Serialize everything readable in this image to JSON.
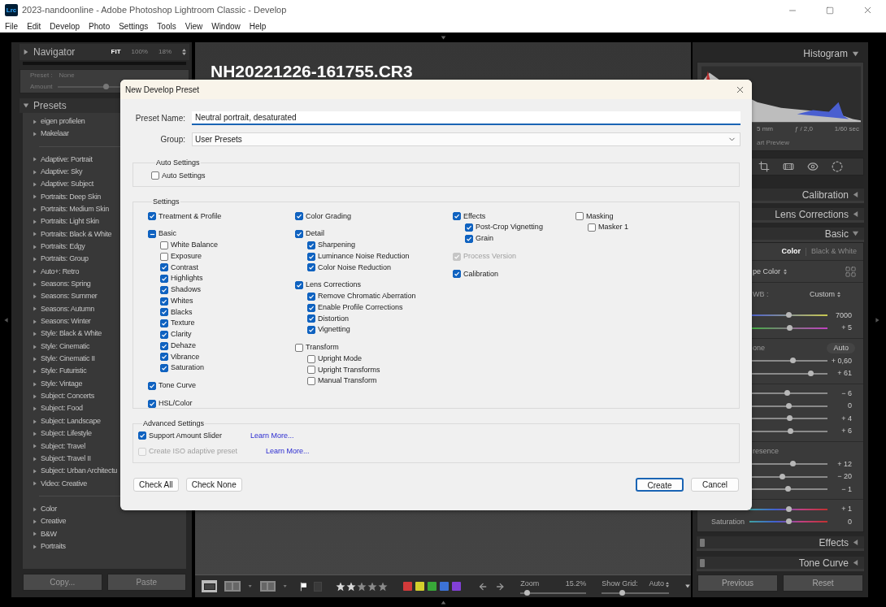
{
  "window": {
    "app_badge": "Lrc",
    "title": "2023-nandoonline - Adobe Photoshop Lightroom Classic - Develop"
  },
  "menu": [
    "File",
    "Edit",
    "Develop",
    "Photo",
    "Settings",
    "Tools",
    "View",
    "Window",
    "Help"
  ],
  "navigator": {
    "title": "Navigator",
    "zoom_options": [
      {
        "label": "FIT",
        "selected": true
      },
      {
        "label": "100%",
        "selected": false
      },
      {
        "label": "18%",
        "selected": false
      }
    ],
    "preset_label": "Preset :",
    "preset_value": "None",
    "amount": {
      "label": "Amount",
      "level": 0.4
    }
  },
  "presets": {
    "title": "Presets",
    "groups": [
      {
        "items": [
          {
            "label": "eigen profielen",
            "expanded": false
          },
          {
            "label": "Makelaar",
            "expanded": false
          }
        ]
      },
      {
        "items": [
          {
            "label": "Adaptive: Portrait",
            "expanded": false
          },
          {
            "label": "Adaptive: Sky",
            "expanded": false
          },
          {
            "label": "Adaptive: Subject",
            "expanded": false
          },
          {
            "label": "Portraits: Deep Skin",
            "expanded": false
          },
          {
            "label": "Portraits: Medium Skin",
            "expanded": false
          },
          {
            "label": "Portraits: Light Skin",
            "expanded": false
          },
          {
            "label": "Portraits: Black & White",
            "expanded": false
          },
          {
            "label": "Portraits: Edgy",
            "expanded": false
          },
          {
            "label": "Portraits: Group",
            "expanded": false
          },
          {
            "label": "Auto+: Retro",
            "expanded": false
          },
          {
            "label": "Seasons: Spring",
            "expanded": false
          },
          {
            "label": "Seasons: Summer",
            "expanded": false
          },
          {
            "label": "Seasons: Autumn",
            "expanded": false
          },
          {
            "label": "Seasons: Winter",
            "expanded": false
          },
          {
            "label": "Style: Black & White",
            "expanded": false
          },
          {
            "label": "Style: Cinematic",
            "expanded": false
          },
          {
            "label": "Style: Cinematic II",
            "expanded": false
          },
          {
            "label": "Style: Futuristic",
            "expanded": false
          },
          {
            "label": "Style: Vintage",
            "expanded": false
          },
          {
            "label": "Subject: Concerts",
            "expanded": false
          },
          {
            "label": "Subject: Food",
            "expanded": false
          },
          {
            "label": "Subject: Landscape",
            "expanded": false
          },
          {
            "label": "Subject: Lifestyle",
            "expanded": false
          },
          {
            "label": "Subject: Travel",
            "expanded": false
          },
          {
            "label": "Subject: Travel II",
            "expanded": false
          },
          {
            "label": "Subject: Urban Architectu",
            "expanded": false
          },
          {
            "label": "Video: Creative",
            "expanded": false
          }
        ]
      },
      {
        "items": [
          {
            "label": "Color",
            "expanded": false
          },
          {
            "label": "Creative",
            "expanded": false
          },
          {
            "label": "B&W",
            "expanded": false
          },
          {
            "label": "Portraits",
            "expanded": false
          }
        ]
      }
    ]
  },
  "left_buttons": [
    "Copy...",
    "Paste"
  ],
  "photo": {
    "filename": "NH20221226-161755.CR3"
  },
  "toolbar": {
    "stars": 2,
    "color_labels": [
      {
        "color": "#d23a3a"
      },
      {
        "color": "#d4cf2c"
      },
      {
        "color": "#38a838"
      },
      {
        "color": "#3c72d6"
      },
      {
        "color": "#8240d6"
      }
    ],
    "zoom": {
      "label": "Zoom",
      "value": "15.2%",
      "level": 0.1
    },
    "grid": {
      "label": "Show Grid:",
      "value": "Auto",
      "level": 0.3
    }
  },
  "right_panel": {
    "histogram_title": "Histogram",
    "exif": [
      "5 mm",
      "ƒ / 2,0",
      "1/60 sec"
    ],
    "preview_note": "art Preview",
    "collapsed_panels": [
      "Calibration",
      "Lens Corrections"
    ],
    "basic": {
      "title": "Basic",
      "treatments": [
        {
          "label": "Color",
          "selected": true
        },
        {
          "label": "Black & White",
          "selected": false
        }
      ],
      "profile": "pe Color",
      "wb_label": "WB :",
      "wb_value": "Custom",
      "sections": [
        {
          "rows": [
            {
              "kind": "temp",
              "value": "7000",
              "level": 0.5
            },
            {
              "kind": "tint",
              "value": "+ 5",
              "level": 0.52
            }
          ]
        },
        {
          "heading": "one",
          "button": "Auto",
          "rows": [
            {
              "kind": "plain",
              "value": "+ 0,60",
              "level": 0.56
            },
            {
              "kind": "plain",
              "value": "+ 61",
              "level": 0.79
            }
          ]
        },
        {
          "rows": [
            {
              "kind": "plain",
              "value": "− 6",
              "level": 0.48
            },
            {
              "kind": "plain",
              "value": "0",
              "level": 0.5
            },
            {
              "kind": "plain",
              "value": "+ 4",
              "level": 0.52
            },
            {
              "kind": "plain",
              "value": "+ 6",
              "level": 0.53
            }
          ]
        },
        {
          "heading": "resence",
          "rows": [
            {
              "kind": "plain",
              "value": "+ 12",
              "level": 0.56
            },
            {
              "kind": "plain",
              "value": "− 20",
              "level": 0.42
            },
            {
              "kind": "plain",
              "value": "− 1",
              "level": 0.49
            }
          ]
        },
        {
          "rows": [
            {
              "kind": "hue",
              "value": "+ 1",
              "level": 0.51
            },
            {
              "kind": "hue",
              "label": "Saturation",
              "value": "0",
              "level": 0.5
            }
          ]
        }
      ]
    },
    "lower_panels": [
      "Effects",
      "Tone Curve"
    ],
    "buttons": [
      "Previous",
      "Reset"
    ]
  },
  "dialog": {
    "title": "New Develop Preset",
    "name_label": "Preset Name:",
    "name_value": "Neutral portrait, desaturated",
    "group_label": "Group:",
    "group_value": "User Presets",
    "auto": {
      "legend": "Auto Settings",
      "items": [
        {
          "label": "Auto Settings",
          "checked": false
        }
      ]
    },
    "settings": {
      "legend": "Settings",
      "columns": [
        [
          {
            "label": "Treatment & Profile",
            "checked": true,
            "disabled": false
          },
          {
            "label": "Basic",
            "checked": true,
            "partial": true,
            "disabled": false,
            "children": [
              {
                "label": "White Balance",
                "checked": false
              },
              {
                "label": "Exposure",
                "checked": false
              },
              {
                "label": "Contrast",
                "checked": true
              },
              {
                "label": "Highlights",
                "checked": true
              },
              {
                "label": "Shadows",
                "checked": true
              },
              {
                "label": "Whites",
                "checked": true
              },
              {
                "label": "Blacks",
                "checked": true
              },
              {
                "label": "Texture",
                "checked": true
              },
              {
                "label": "Clarity",
                "checked": true
              },
              {
                "label": "Dehaze",
                "checked": true
              },
              {
                "label": "Vibrance",
                "checked": true
              },
              {
                "label": "Saturation",
                "checked": true
              }
            ]
          },
          {
            "label": "Tone Curve",
            "checked": true,
            "disabled": false
          },
          {
            "label": "HSL/Color",
            "checked": true,
            "disabled": false
          }
        ],
        [
          {
            "label": "Color Grading",
            "checked": true,
            "disabled": false
          },
          {
            "label": "Detail",
            "checked": true,
            "disabled": false,
            "children": [
              {
                "label": "Sharpening",
                "checked": true
              },
              {
                "label": "Luminance Noise Reduction",
                "checked": true
              },
              {
                "label": "Color Noise Reduction",
                "checked": true
              }
            ]
          },
          {
            "label": "Lens Corrections",
            "checked": true,
            "disabled": false,
            "children": [
              {
                "label": "Remove Chromatic Aberration",
                "checked": true
              },
              {
                "label": "Enable Profile Corrections",
                "checked": true
              },
              {
                "label": "Distortion",
                "checked": true
              },
              {
                "label": "Vignetting",
                "checked": true
              }
            ]
          },
          {
            "label": "Transform",
            "checked": false,
            "disabled": false,
            "children": [
              {
                "label": "Upright Mode",
                "checked": false
              },
              {
                "label": "Upright Transforms",
                "checked": false
              },
              {
                "label": "Manual Transform",
                "checked": false
              }
            ]
          }
        ],
        [
          {
            "label": "Effects",
            "checked": true,
            "disabled": false,
            "children": [
              {
                "label": "Post-Crop Vignetting",
                "checked": true
              },
              {
                "label": "Grain",
                "checked": true
              }
            ]
          },
          {
            "label": "Process Version",
            "checked": true,
            "disabled": true
          },
          {
            "label": "Calibration",
            "checked": true,
            "disabled": false
          }
        ],
        [
          {
            "label": "Masking",
            "checked": false,
            "disabled": false,
            "children": [
              {
                "label": "Masker 1",
                "checked": false
              }
            ]
          }
        ]
      ]
    },
    "advanced": {
      "legend": "Advanced Settings",
      "items": [
        {
          "label": "Support Amount Slider",
          "checked": true,
          "disabled": false,
          "link": "Learn More..."
        },
        {
          "label": "Create ISO adaptive preset",
          "checked": false,
          "disabled": true,
          "link": "Learn More..."
        }
      ]
    },
    "left_buttons": [
      "Check All",
      "Check None"
    ],
    "right_buttons": [
      {
        "label": "Create",
        "default": true
      },
      {
        "label": "Cancel",
        "default": false
      }
    ]
  }
}
